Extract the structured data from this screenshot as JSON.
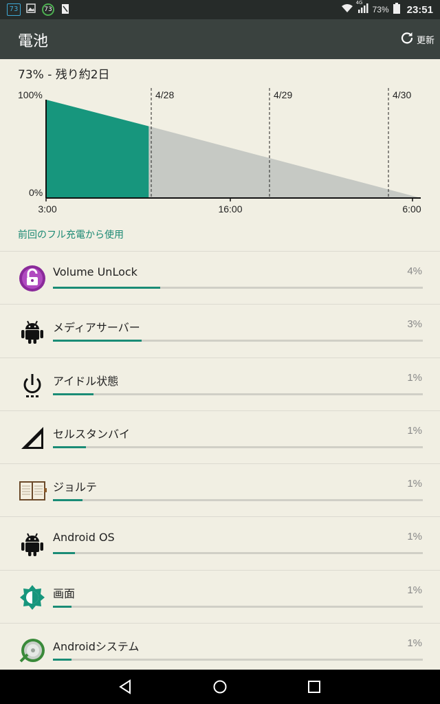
{
  "status_bar": {
    "notif1": "73",
    "notif3": "73",
    "network": "4G",
    "battery_pct": "73%",
    "time": "23:51",
    "icons": [
      "notification-73-icon",
      "image-icon",
      "battery-saver-73-icon",
      "file-icon",
      "wifi-icon",
      "signal-icon",
      "battery-icon"
    ]
  },
  "app_bar": {
    "title": "電池",
    "refresh_label": "更新"
  },
  "summary": "73% - 残り約2日",
  "chart_data": {
    "type": "area",
    "ytick_labels": [
      "100%",
      "0%"
    ],
    "xtick_labels": [
      "3:00",
      "16:00",
      "6:00"
    ],
    "date_markers": [
      "4/28",
      "4/29",
      "4/30"
    ],
    "ylim": [
      0,
      100
    ],
    "series": [
      {
        "x": [
          0,
          0.274
        ],
        "values": [
          100,
          73
        ],
        "color": "#17967d"
      },
      {
        "x": [
          0.274,
          1.0
        ],
        "values": [
          73,
          0
        ],
        "color": "#c6c9c4"
      }
    ]
  },
  "section_header": "前回のフル充電から使用",
  "usage": [
    {
      "name": "Volume UnLock",
      "pct": "4%",
      "fill": 0.29,
      "icon": "lock-icon"
    },
    {
      "name": "メディアサーバー",
      "pct": "3%",
      "fill": 0.24,
      "icon": "android-icon"
    },
    {
      "name": "アイドル状態",
      "pct": "1%",
      "fill": 0.11,
      "icon": "power-icon"
    },
    {
      "name": "セルスタンバイ",
      "pct": "1%",
      "fill": 0.09,
      "icon": "cell-signal-icon"
    },
    {
      "name": "ジョルテ",
      "pct": "1%",
      "fill": 0.08,
      "icon": "planner-icon"
    },
    {
      "name": "Android OS",
      "pct": "1%",
      "fill": 0.06,
      "icon": "android-icon"
    },
    {
      "name": "画面",
      "pct": "1%",
      "fill": 0.05,
      "icon": "brightness-icon"
    },
    {
      "name": "Androidシステム",
      "pct": "1%",
      "fill": 0.05,
      "icon": "android-system-icon"
    }
  ],
  "nav": [
    "back-icon",
    "home-icon",
    "recents-icon"
  ]
}
